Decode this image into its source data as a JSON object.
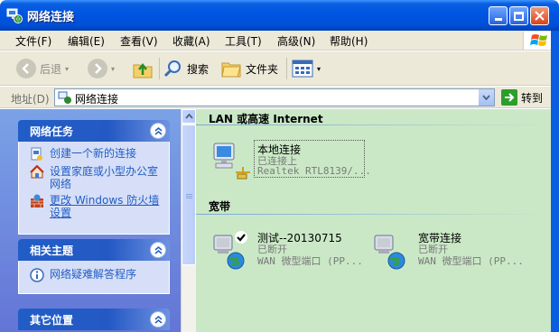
{
  "window": {
    "title": "网络连接",
    "minimize_label": "_",
    "maximize_label": "□",
    "close_label": "✕"
  },
  "menu": {
    "items": [
      "文件(F)",
      "编辑(E)",
      "查看(V)",
      "收藏(A)",
      "工具(T)",
      "高级(N)",
      "帮助(H)"
    ]
  },
  "toolbar": {
    "back_label": "后退",
    "search_label": "搜索",
    "folders_label": "文件夹"
  },
  "address": {
    "label": "地址(D)",
    "value": "网络连接",
    "go_label": "转到"
  },
  "tasks_pane": {
    "network_tasks": {
      "title": "网络任务",
      "items": [
        {
          "label": "创建一个新的连接",
          "icon": "new-connection-icon"
        },
        {
          "label": "设置家庭或小型办公室网络",
          "icon": "home-network-icon"
        },
        {
          "label": "更改 Windows 防火墙设置",
          "icon": "firewall-icon"
        }
      ]
    },
    "related": {
      "title": "相关主题",
      "items": [
        {
          "label": "网络疑难解答程序",
          "icon": "info-icon"
        }
      ]
    },
    "other_places": {
      "title": "其它位置"
    }
  },
  "groups": [
    {
      "header": "LAN 或高速 Internet",
      "connections": [
        {
          "name": "本地连接",
          "status": "已连接上",
          "device": "Realtek RTL8139/..."
        }
      ]
    },
    {
      "header": "宽带",
      "connections": [
        {
          "name": "测试--20130715",
          "status": "已断开",
          "device": "WAN 微型端口 (PP..."
        },
        {
          "name": "宽带连接",
          "status": "已断开",
          "device": "WAN 微型端口 (PP..."
        }
      ]
    }
  ],
  "colors": {
    "title_bar": "#0054e3",
    "content_bg": "#cae8c6",
    "task_link": "#215dc6",
    "panel_header": "#215dc6"
  }
}
